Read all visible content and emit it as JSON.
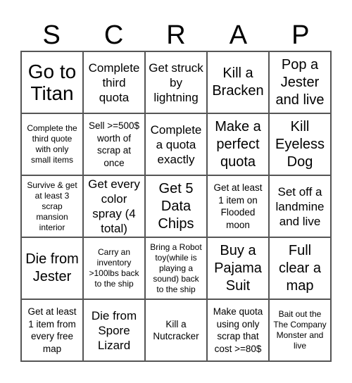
{
  "title_letters": [
    "S",
    "C",
    "R",
    "A",
    "P"
  ],
  "cells": [
    {
      "text": "Go to Titan",
      "size": "s-xl"
    },
    {
      "text": "Complete third quota",
      "size": "s-m"
    },
    {
      "text": "Get struck by lightning",
      "size": "s-m"
    },
    {
      "text": "Kill a Bracken",
      "size": "s-l"
    },
    {
      "text": "Pop a Jester and live",
      "size": "s-l"
    },
    {
      "text": "Complete the third quote with only small items",
      "size": "s-xs"
    },
    {
      "text": "Sell >=500$ worth of scrap at once",
      "size": "s-s"
    },
    {
      "text": "Complete a quota exactly",
      "size": "s-m"
    },
    {
      "text": "Make a perfect quota",
      "size": "s-l"
    },
    {
      "text": "Kill Eyeless Dog",
      "size": "s-l"
    },
    {
      "text": "Survive & get at least 3 scrap mansion interior",
      "size": "s-xs"
    },
    {
      "text": "Get every color spray (4 total)",
      "size": "s-m"
    },
    {
      "text": "Get 5 Data Chips",
      "size": "s-l"
    },
    {
      "text": "Get at least 1 item on Flooded moon",
      "size": "s-s"
    },
    {
      "text": "Set off a landmine and live",
      "size": "s-m"
    },
    {
      "text": "Die from Jester",
      "size": "s-l"
    },
    {
      "text": "Carry an inventory >100lbs back to the ship",
      "size": "s-xs"
    },
    {
      "text": "Bring a Robot toy(while is playing a sound) back to the ship",
      "size": "s-xs"
    },
    {
      "text": "Buy a Pajama Suit",
      "size": "s-l"
    },
    {
      "text": "Full clear a map",
      "size": "s-l"
    },
    {
      "text": "Get at least 1 item from every free map",
      "size": "s-s"
    },
    {
      "text": "Die from Spore Lizard",
      "size": "s-m"
    },
    {
      "text": "Kill a Nutcracker",
      "size": "s-s"
    },
    {
      "text": "Make quota using only scrap that cost >=80$",
      "size": "s-s"
    },
    {
      "text": "Bait out the The Company Monster and live",
      "size": "s-xs"
    }
  ]
}
